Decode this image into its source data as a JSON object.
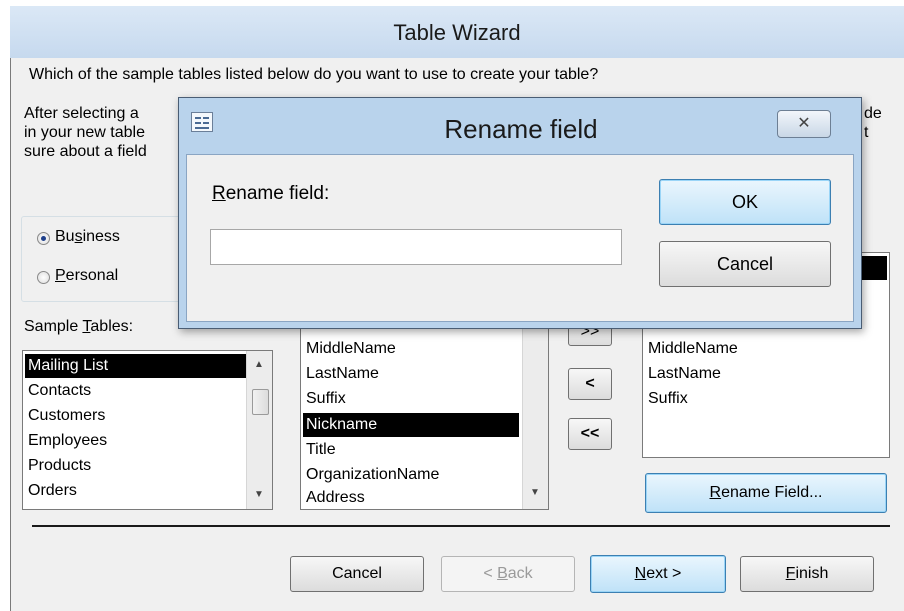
{
  "wizard": {
    "title": "Table Wizard",
    "question": "Which of the sample tables listed below do you want to use to create your table?",
    "instructions": {
      "line1": "After selecting a",
      "line1_right": "de",
      "line2": "in your new table",
      "line2_right": "t",
      "line3": "sure about a field"
    },
    "radios": {
      "business": {
        "pre": "Bu",
        "accel": "s",
        "post": "iness",
        "checked": true
      },
      "personal": {
        "pre": "",
        "accel": "P",
        "post": "ersonal",
        "checked": false
      }
    },
    "sample_tables": {
      "label_pre": "Sample ",
      "label_accel": "T",
      "label_post": "ables:",
      "items": [
        "Mailing List",
        "Contacts",
        "Customers",
        "Employees",
        "Products",
        "Orders"
      ],
      "selected": "Mailing List"
    },
    "sample_fields": {
      "items": [
        "MiddleName",
        "LastName",
        "Suffix",
        "Nickname",
        "Title",
        "OrganizationName",
        "Address"
      ],
      "selected": "Nickname"
    },
    "move_buttons": {
      "add_all": ">>",
      "remove": "<",
      "remove_all": "<<"
    },
    "new_fields": {
      "items": [
        "MiddleName",
        "LastName",
        "Suffix"
      ]
    },
    "rename_field_button": {
      "accel": "R",
      "post": "ename Field..."
    },
    "footer": {
      "cancel": "Cancel",
      "back": {
        "pre": "< ",
        "accel": "B",
        "post": "ack"
      },
      "next": {
        "accel": "N",
        "post": "ext >"
      },
      "finish": {
        "accel": "F",
        "post": "inish"
      }
    }
  },
  "rename_dialog": {
    "title": "Rename field",
    "label": {
      "accel": "R",
      "post": "ename field:"
    },
    "input_value": "",
    "ok": "OK",
    "cancel": "Cancel",
    "close_glyph": "✕"
  },
  "colors": {
    "selection": "#000000",
    "default_button": "#3c7fb1",
    "dialog_frame": "#b9d3ec"
  }
}
